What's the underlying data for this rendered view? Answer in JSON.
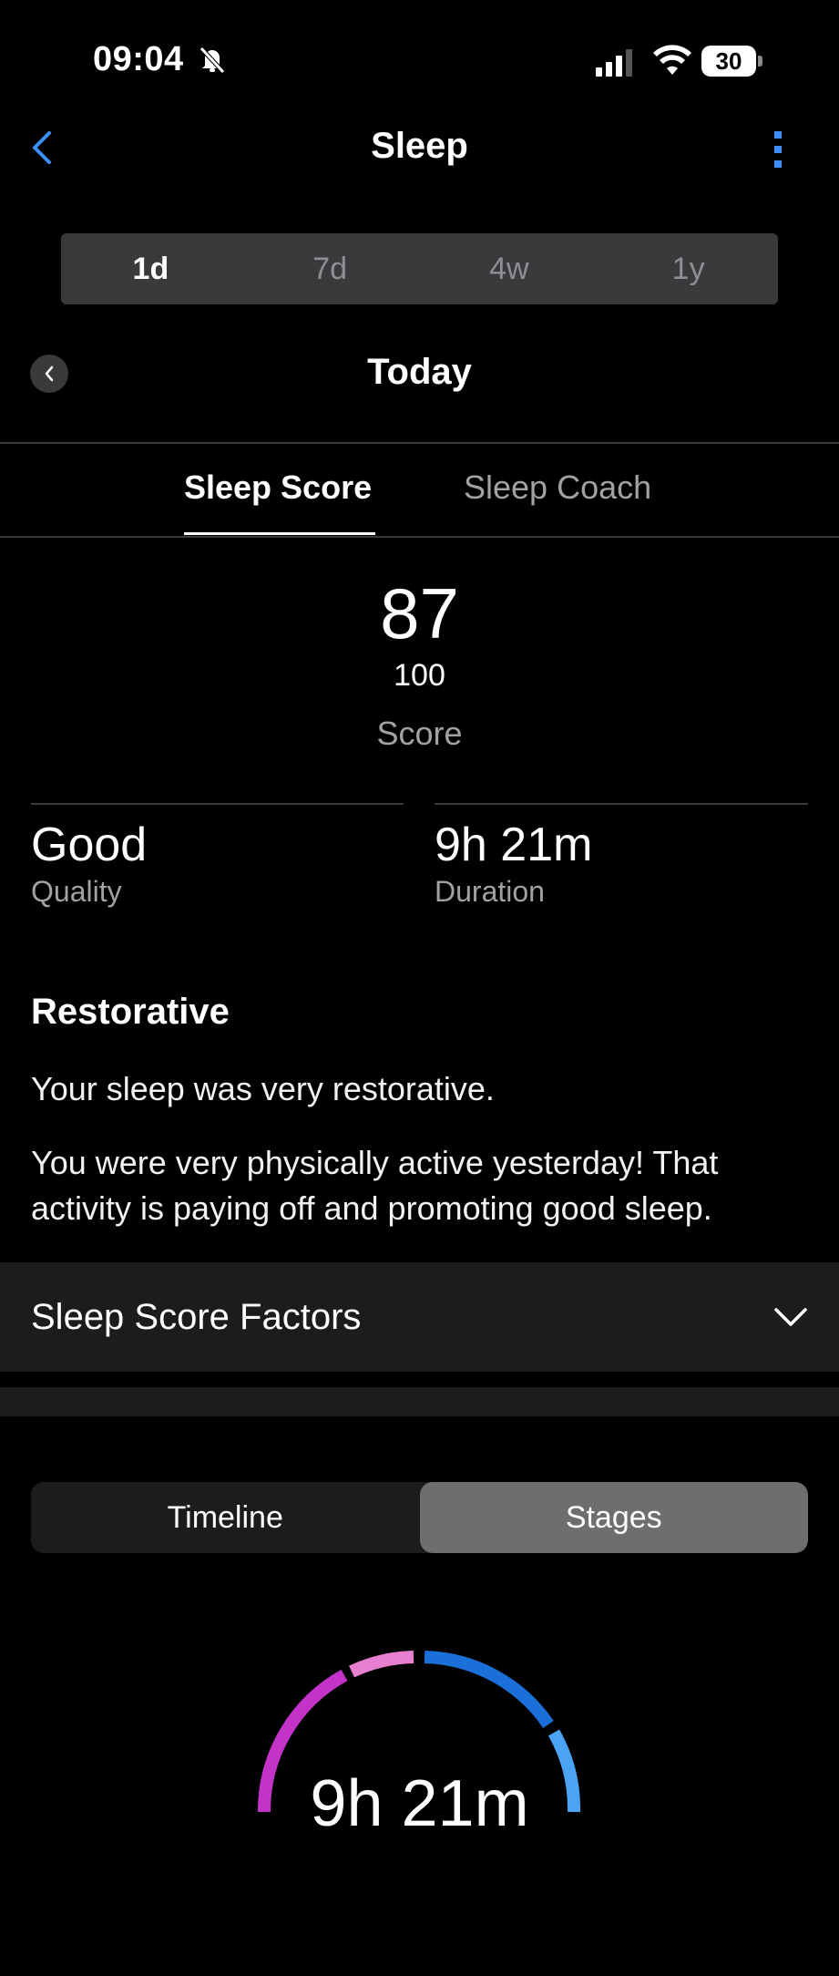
{
  "status": {
    "time": "09:04",
    "battery": "30"
  },
  "nav": {
    "title": "Sleep"
  },
  "periods": [
    "1d",
    "7d",
    "4w",
    "1y"
  ],
  "date": {
    "label": "Today"
  },
  "tabs": [
    "Sleep Score",
    "Sleep Coach"
  ],
  "score": {
    "value": "87",
    "max": "100",
    "label": "Score"
  },
  "stats": {
    "quality": {
      "value": "Good",
      "label": "Quality"
    },
    "duration": {
      "value": "9h 21m",
      "label": "Duration"
    }
  },
  "insight": {
    "title": "Restorative",
    "line1": "Your sleep was very restorative.",
    "line2": "You were very physically active yesterday! That activity is paying off and promoting good sleep."
  },
  "factors": {
    "label": "Sleep Score Factors"
  },
  "views": [
    "Timeline",
    "Stages"
  ],
  "ring": {
    "label": "9h 21m"
  },
  "colors": {
    "accent": "#3a8ff7",
    "deep": "#1a6fd8",
    "light": "#4aa3f5",
    "rem": "#c433c8",
    "awake": "#e87fd0"
  }
}
